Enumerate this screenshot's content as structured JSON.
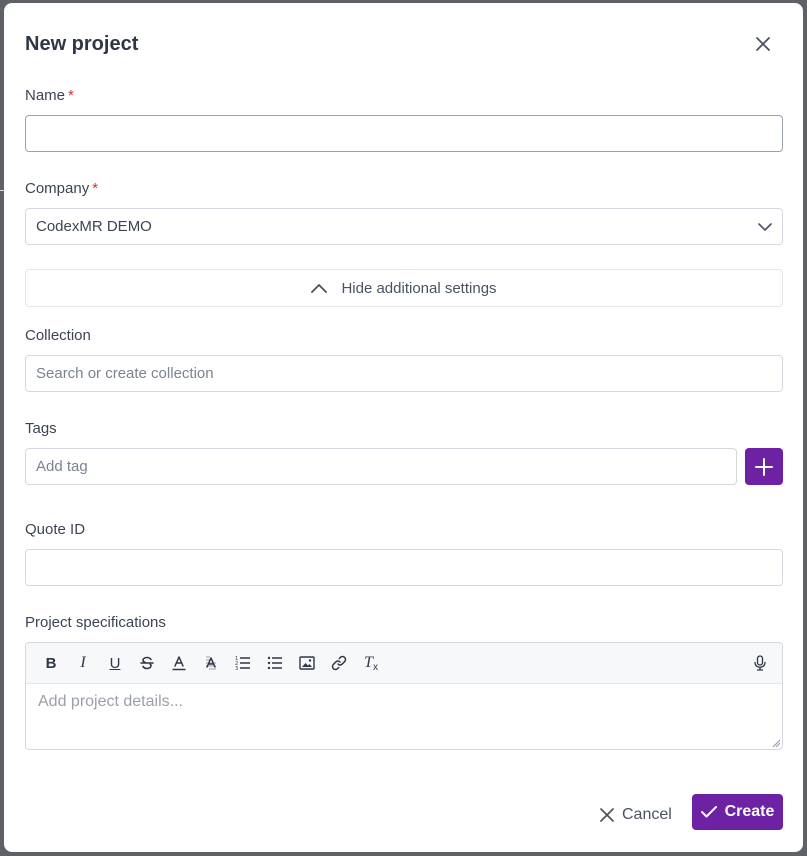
{
  "modal": {
    "title": "New project"
  },
  "fields": {
    "name": {
      "label": "Name",
      "required_mark": "*",
      "value": ""
    },
    "company": {
      "label": "Company",
      "required_mark": "*",
      "value": "CodexMR DEMO"
    },
    "collection": {
      "label": "Collection",
      "placeholder": "Search or create collection"
    },
    "tags": {
      "label": "Tags",
      "placeholder": "Add tag"
    },
    "quote_id": {
      "label": "Quote ID",
      "value": ""
    },
    "specs": {
      "label": "Project specifications",
      "placeholder": "Add project details..."
    }
  },
  "additional_settings": {
    "label": "Hide additional settings",
    "icon": "chevron-up-icon"
  },
  "toolbar": {
    "bold": "B",
    "italic": "I",
    "underline": "U",
    "clear_format": "T"
  },
  "footer": {
    "cancel_label": "Cancel",
    "create_label": "Create"
  },
  "colors": {
    "primary": "#6d21a3",
    "required": "#e03131",
    "text": "#3c4453"
  }
}
